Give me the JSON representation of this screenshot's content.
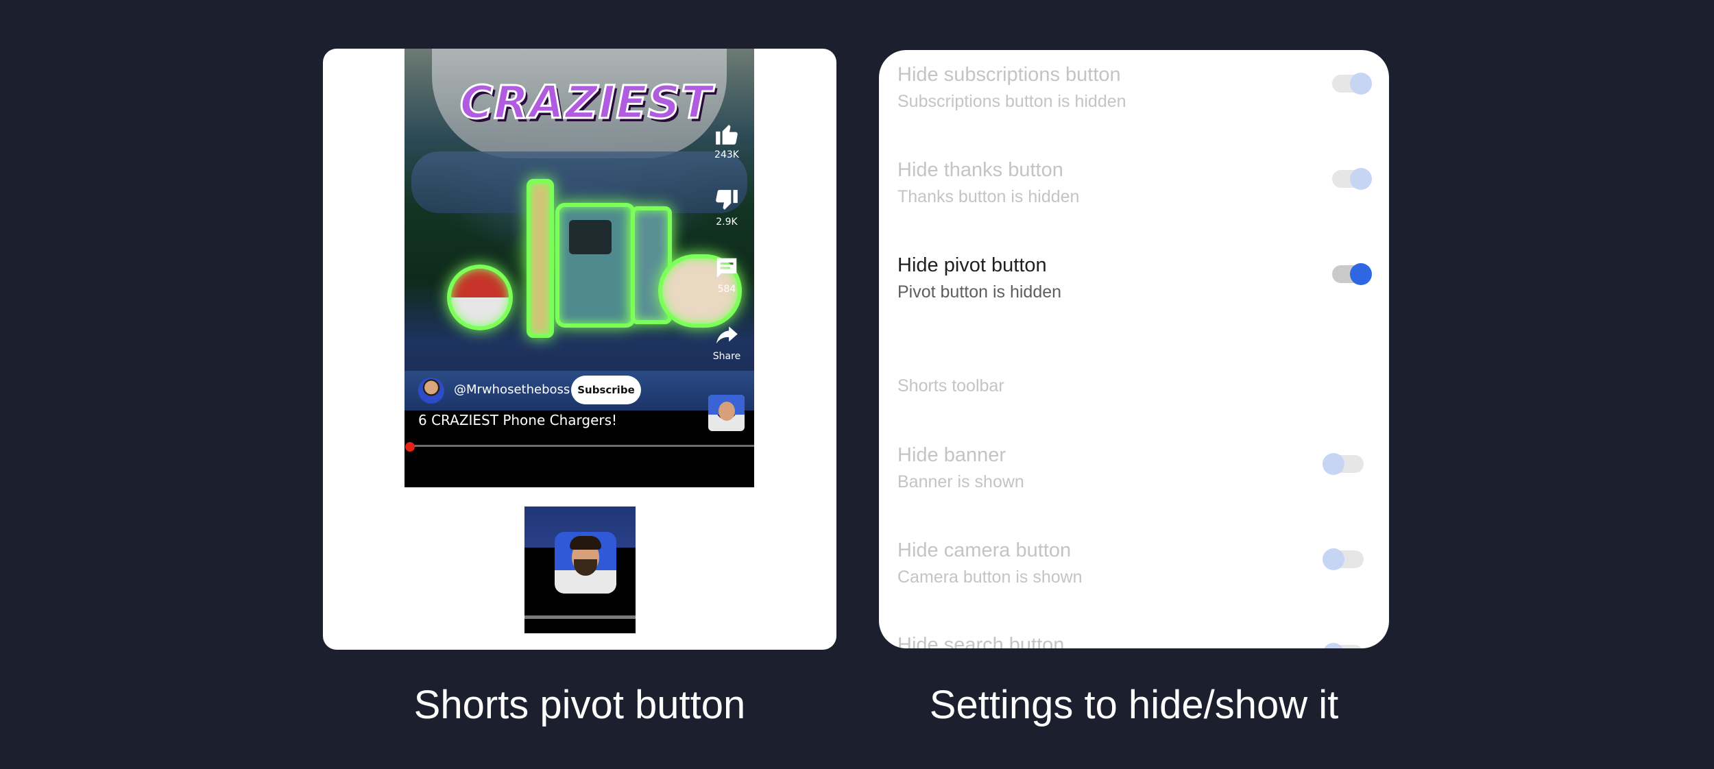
{
  "left_panel": {
    "video": {
      "thumbnail_title_art": "CRAZIEST",
      "actions": [
        {
          "icon": "thumbs-up-icon",
          "label": "243K"
        },
        {
          "icon": "thumbs-down-icon",
          "label": "2.9K"
        },
        {
          "icon": "comment-icon",
          "label": "584"
        },
        {
          "icon": "share-icon",
          "label": "Share"
        }
      ],
      "channel_handle": "@Mrwhosetheboss",
      "subscribe_label": "Subscribe",
      "caption": "6 CRAZIEST Phone Chargers!",
      "progress": 0.01
    },
    "caption_below": "Shorts pivot button"
  },
  "right_panel": {
    "settings": [
      {
        "title": "Hide subscriptions button",
        "subtitle": "Subscriptions button is hidden",
        "state": "on",
        "faded": true
      },
      {
        "title": "Hide thanks button",
        "subtitle": "Thanks button is hidden",
        "state": "on",
        "faded": true
      },
      {
        "title": "Hide pivot button",
        "subtitle": "Pivot button is hidden",
        "state": "on",
        "faded": false
      }
    ],
    "section_label": "Shorts toolbar",
    "toolbar_settings": [
      {
        "title": "Hide banner",
        "subtitle": "Banner is shown",
        "state": "off",
        "faded": true
      },
      {
        "title": "Hide camera button",
        "subtitle": "Camera button is shown",
        "state": "off",
        "faded": true
      },
      {
        "title": "Hide search button",
        "subtitle": "",
        "state": "off",
        "faded": true
      }
    ],
    "caption_below": "Settings to hide/show it"
  },
  "colors": {
    "background": "#1c1f2d",
    "accent": "#2f66e4",
    "accent_faded": "#c7d5f5",
    "progress_red": "#e62117"
  }
}
